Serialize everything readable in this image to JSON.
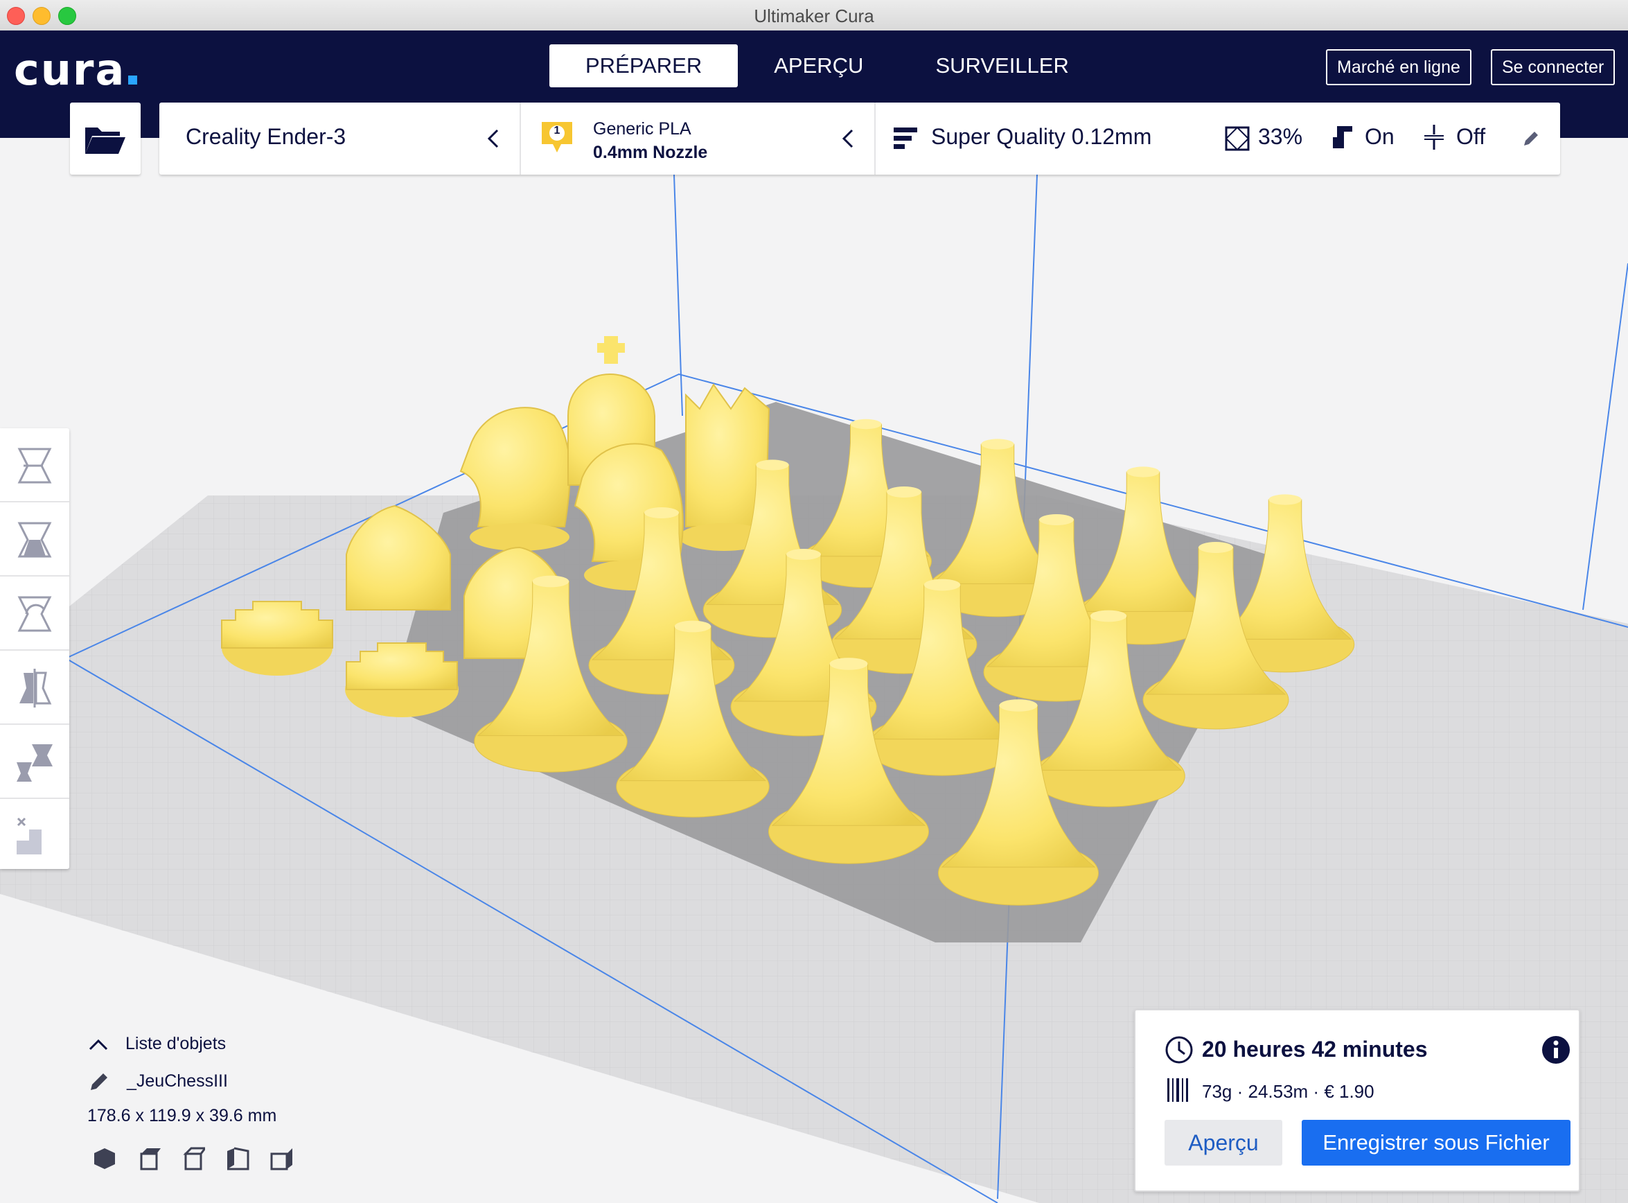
{
  "window": {
    "title": "Ultimaker Cura"
  },
  "header": {
    "logo_text": "cura",
    "stages": [
      {
        "label": "PRÉPARER",
        "active": true
      },
      {
        "label": "APERÇU",
        "active": false
      },
      {
        "label": "SURVEILLER",
        "active": false
      }
    ],
    "marketplace_label": "Marché en ligne",
    "signin_label": "Se connecter"
  },
  "printer": {
    "name": "Creality Ender-3"
  },
  "material": {
    "badge": "1",
    "name": "Generic PLA",
    "nozzle": "0.4mm Nozzle"
  },
  "print_settings": {
    "profile": "Super Quality 0.12mm",
    "infill": "33%",
    "support": "On",
    "adhesion": "Off"
  },
  "tools": [
    "move-tool",
    "scale-tool",
    "rotate-tool",
    "mirror-tool",
    "per-model-settings-tool",
    "support-blocker-tool"
  ],
  "object_list": {
    "title": "Liste d'objets",
    "job_name": "_JeuChessIII",
    "dimensions": "178.6 x 119.9 x 39.6 mm"
  },
  "summary": {
    "time": "20 heures 42 minutes",
    "material_usage": "73g · 24.53m · € 1.90",
    "preview_label": "Aperçu",
    "save_label": "Enregistrer sous Fichier"
  },
  "colors": {
    "header_bg": "#0c1140",
    "accent_blue": "#196ef0",
    "model_yellow": "#fbe46c",
    "build_plate": "#dcdcde"
  }
}
